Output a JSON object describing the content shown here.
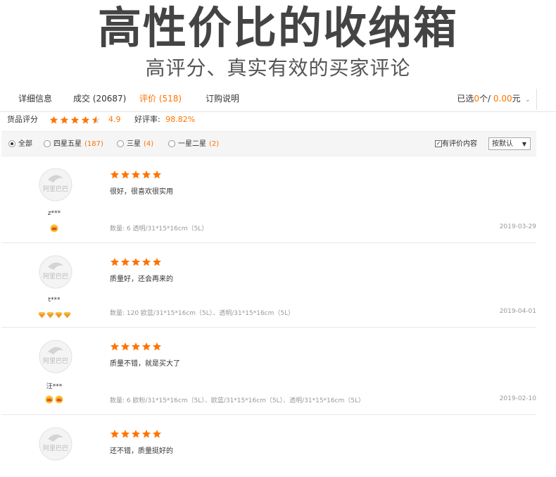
{
  "banner": {
    "title": "高性价比的收纳箱",
    "subtitle": "高评分、真实有效的买家评论"
  },
  "tabs": [
    {
      "label": "详细信息",
      "active": false
    },
    {
      "label": "成交 (20687)",
      "active": false
    },
    {
      "label": "评价 (518)",
      "active": true
    },
    {
      "label": "订购说明",
      "active": false
    }
  ],
  "selection": {
    "prefix": "已选",
    "count": "0",
    "unit": "个/",
    "amount": "0.00",
    "currency": "元"
  },
  "rating": {
    "label": "货品评分",
    "score": "4.9",
    "stars": 4.9,
    "positive_label": "好评率:",
    "positive_value": "98.82%"
  },
  "filters": {
    "options": [
      {
        "label": "全部",
        "count": "",
        "selected": true
      },
      {
        "label": "四星五星",
        "count": "(187)",
        "selected": false
      },
      {
        "label": "三星",
        "count": "(4)",
        "selected": false
      },
      {
        "label": "一星二星",
        "count": "(2)",
        "selected": false
      }
    ],
    "has_content_label": "有评价内容",
    "has_content_checked": true,
    "sort_label": "按默认"
  },
  "reviews": [
    {
      "user": "z***",
      "stars": 5,
      "text": "很好，很喜欢很实用",
      "meta": "数量: 6   透明/31*15*16cm（5L）",
      "date": "2019-03-29",
      "badge": "crown",
      "badge_count": 1
    },
    {
      "user": "t***",
      "stars": 5,
      "text": "质量好，还会再来的",
      "meta": "数量: 120   欧蓝/31*15*16cm（5L）、透明/31*15*16cm（5L）",
      "date": "2019-04-01",
      "badge": "diamond",
      "badge_count": 4
    },
    {
      "user": "汪***",
      "stars": 5,
      "text": "质量不错，就是买大了",
      "meta": "数量: 6   欧粉/31*15*16cm（5L）、欧蓝/31*15*16cm（5L）、透明/31*15*16cm（5L）",
      "date": "2019-02-10",
      "badge": "crown",
      "badge_count": 2
    },
    {
      "user": "",
      "stars": 5,
      "text": "还不错，质量挺好的",
      "meta": "",
      "date": "",
      "badge": "",
      "badge_count": 0
    }
  ],
  "colors": {
    "accent": "#ff7300",
    "star": "#ff7300"
  },
  "avatar_logo": "阿里巴巴"
}
